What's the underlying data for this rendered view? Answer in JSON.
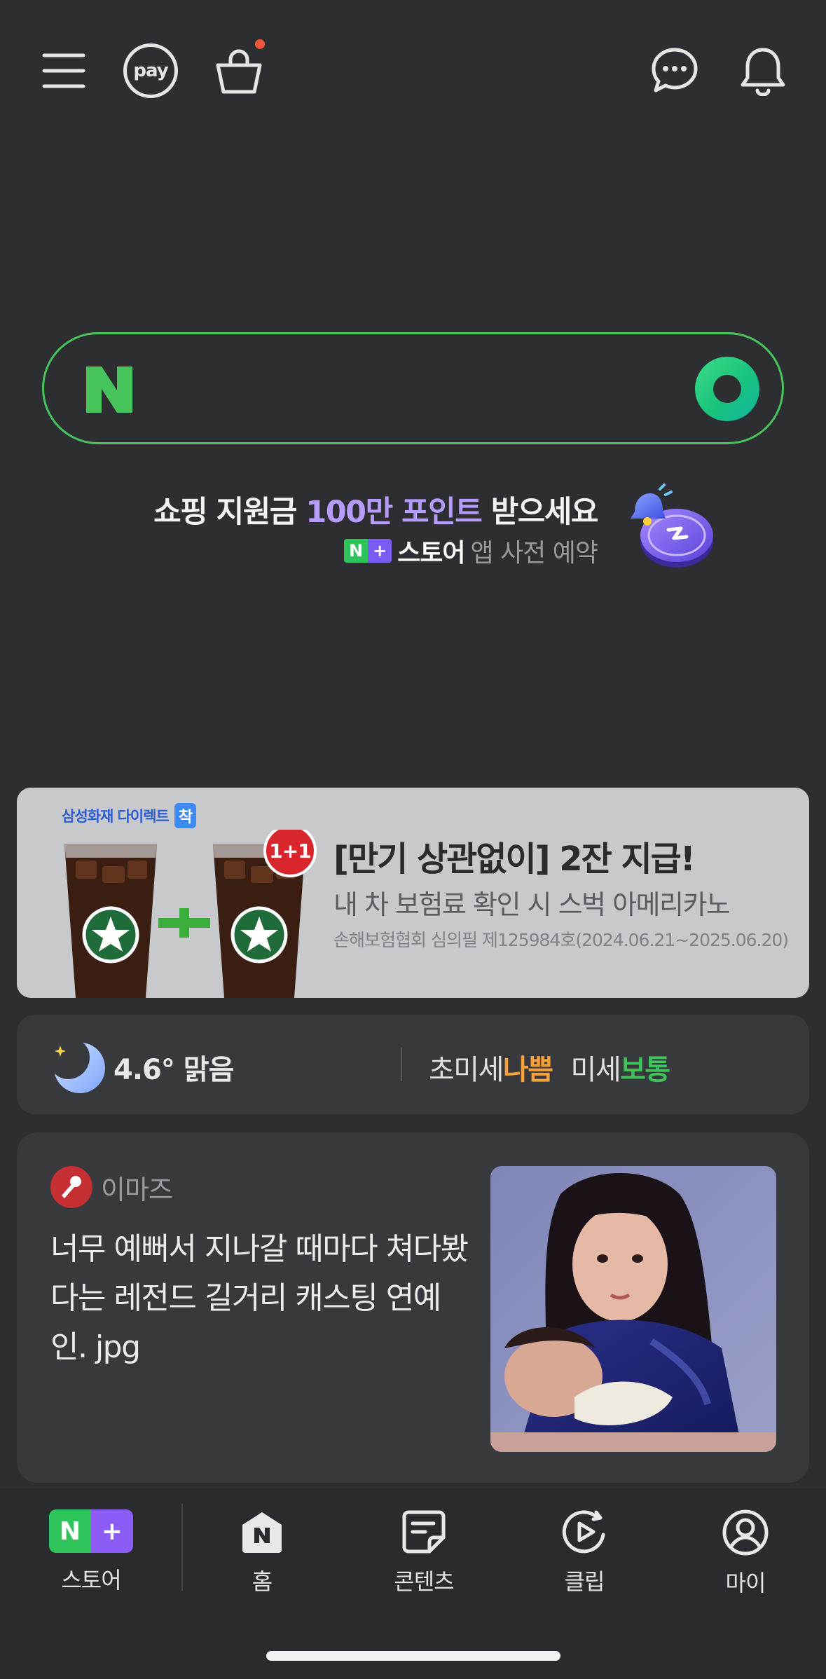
{
  "topbar": {
    "pay_label": "pay",
    "cart_has_notification": true,
    "icons": [
      "menu-icon",
      "pay-icon",
      "cart-icon",
      "chat-icon",
      "bell-icon"
    ]
  },
  "search": {
    "logo": "N",
    "accent": "#46c35b"
  },
  "promo": {
    "prefix": "쇼핑 지원금 ",
    "highlight": "100만 포인트",
    "suffix": " 받으세요",
    "badge_n": "N",
    "badge_plus": "+",
    "store": "스토어",
    "sub": " 앱 사전 예약",
    "highlight_color": "#b79cff"
  },
  "ad": {
    "brand": "삼성화재 다이렉트",
    "brand_badge": "착",
    "badge": "1+1",
    "title": "[만기 상관없이] 2잔 지급!",
    "desc": "내 차 보험료 확인 시 스벅 아메리카노",
    "legal": "손해보험협회 심의필 제125984호(2024.06.21~2025.06.20)"
  },
  "weather": {
    "temp": "4.6° 맑음",
    "fine_dust_label": "초미세",
    "fine_dust_value": "나쁨",
    "dust_label": "미세",
    "dust_value": "보통",
    "bad_color": "#f5a03a",
    "ok_color": "#3fc35a"
  },
  "news": {
    "source": "이마즈",
    "title": "너무 예뻐서 지나갈 때마다 쳐다봤다는 레전드 길거리 캐스팅 연예인. jpg"
  },
  "bottomnav": {
    "store": {
      "n": "N",
      "plus": "+",
      "label": "스토어"
    },
    "home": {
      "label": "홈",
      "icon_letter": "N"
    },
    "content": {
      "label": "콘텐츠"
    },
    "clip": {
      "label": "클립"
    },
    "my": {
      "label": "마이"
    }
  }
}
